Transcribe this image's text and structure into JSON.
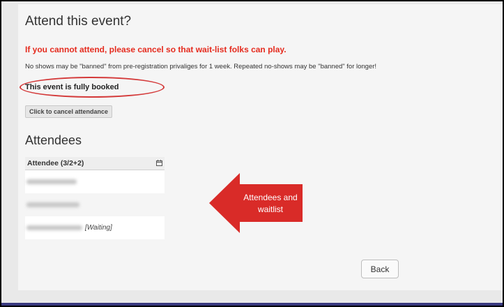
{
  "event": {
    "heading": "Attend this event?",
    "warning": "If you cannot attend, please cancel so that wait-list folks can play.",
    "note": "No shows may be \"banned\" from pre-registration privaliges for 1 week. Repeated no-shows may be \"banned\" for longer!",
    "status": "This event is fully booked",
    "cancel_label": "Click to cancel attendance"
  },
  "attendees": {
    "title": "Attendees",
    "column_header": "Attendee (3/2+2)",
    "header_icon": "calendar-icon",
    "rows": [
      {
        "name": "",
        "waiting": ""
      },
      {
        "name": "",
        "waiting": ""
      },
      {
        "name": "",
        "waiting": "[Waiting]"
      }
    ]
  },
  "callout": {
    "line1": "Attendees and",
    "line2": "waitlist",
    "color": "#d92b28"
  },
  "footer": {
    "back_label": "Back"
  },
  "colors": {
    "warning": "#e52b1e",
    "annotation": "#d43a3a"
  }
}
